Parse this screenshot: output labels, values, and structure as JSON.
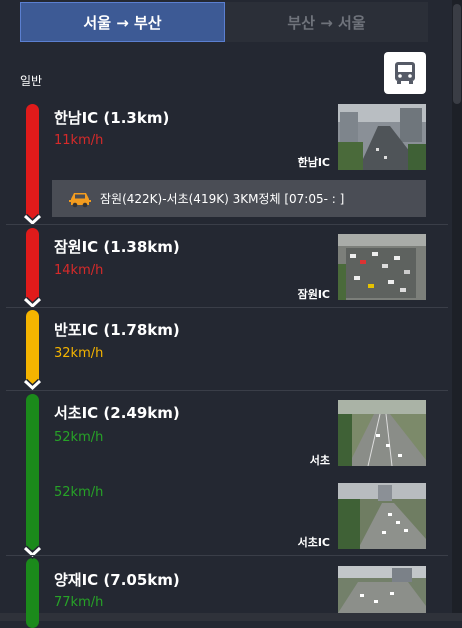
{
  "tabs": [
    {
      "label": "서울 → 부산",
      "active": true
    },
    {
      "label": "부산 → 서울",
      "active": false
    }
  ],
  "section_label": "일반",
  "bus_icon": "bus-icon",
  "colors": {
    "red": "#e01b1b",
    "yellow": "#f5b400",
    "green": "#1b8a1b",
    "active_tab": "#3d5a95"
  },
  "segments": [
    {
      "ic": "한남IC (1.3km)",
      "speed": "11km/h",
      "speed_color": "#d62a2a",
      "cam_label": "한남IC",
      "status": "red"
    },
    {
      "ic": "잠원IC (1.38km)",
      "speed": "14km/h",
      "speed_color": "#d62a2a",
      "cam_label": "잠원IC",
      "status": "red"
    },
    {
      "ic": "반포IC (1.78km)",
      "speed": "32km/h",
      "speed_color": "#f5b400",
      "status": "yellow"
    },
    {
      "ic": "서초IC (2.49km)",
      "speed": "52km/h",
      "speed_color": "#27a327",
      "cam_label": "서초",
      "status": "green"
    },
    {
      "speed": "52km/h",
      "speed_color": "#27a327",
      "cam_label": "서초IC",
      "status": "green"
    },
    {
      "ic": "양재IC (7.05km)",
      "speed": "77km/h",
      "speed_color": "#27a327",
      "status": "green"
    }
  ],
  "alert": {
    "icon": "car-accident-icon",
    "text": "잠원(422K)-서초(419K) 3KM정체 [07:05- : ]"
  }
}
